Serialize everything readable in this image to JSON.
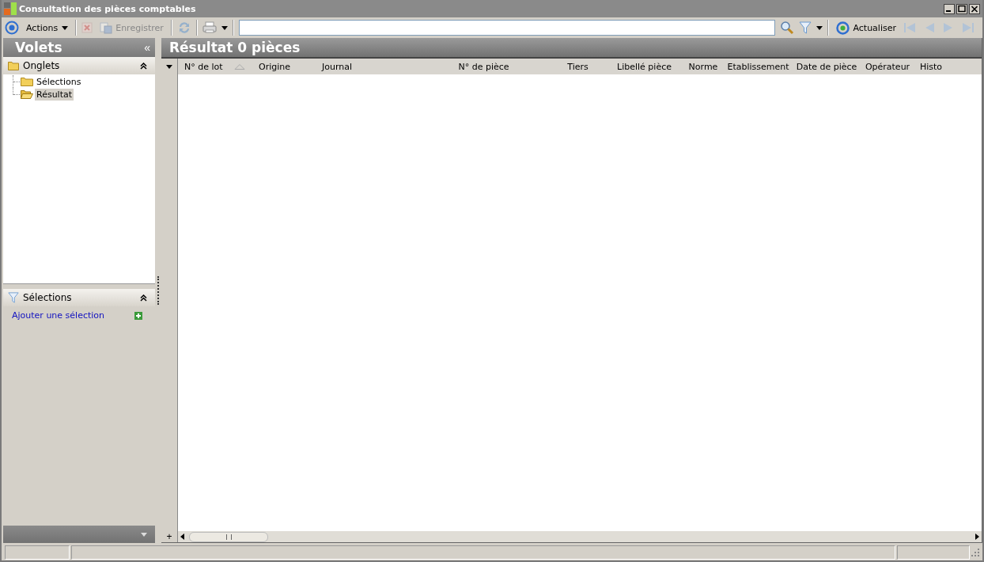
{
  "window": {
    "title": "Consultation des pièces comptables"
  },
  "toolbar": {
    "actions_label": "Actions",
    "delete_disabled": true,
    "save": {
      "label": "Enregistrer",
      "disabled": true
    },
    "refresh_label": "Actualiser",
    "nav_disabled": true
  },
  "side_panel": {
    "title": "Volets",
    "collapse": "«",
    "tabs_section": {
      "title": "Onglets",
      "items": [
        {
          "label": "Sélections",
          "selected": false
        },
        {
          "label": "Résultat",
          "selected": true
        }
      ]
    },
    "selections_section": {
      "title": "Sélections",
      "link": "Ajouter une sélection"
    }
  },
  "result": {
    "title": "Résultat 0 pièces",
    "columns": [
      {
        "label": "N° de lot",
        "sorted": true
      },
      {
        "label": "Origine",
        "sorted": false
      },
      {
        "label": "Journal",
        "sorted": false
      },
      {
        "label": "N° de pièce",
        "sorted": false
      },
      {
        "label": "Tiers",
        "sorted": false
      },
      {
        "label": "Libellé pièce",
        "sorted": false
      },
      {
        "label": "Norme",
        "sorted": false
      },
      {
        "label": "Etablissement",
        "sorted": false
      },
      {
        "label": "Date de pièce",
        "sorted": false
      },
      {
        "label": "Opérateur",
        "sorted": false
      },
      {
        "label": "Histo",
        "sorted": false
      }
    ],
    "add_row": "+"
  }
}
